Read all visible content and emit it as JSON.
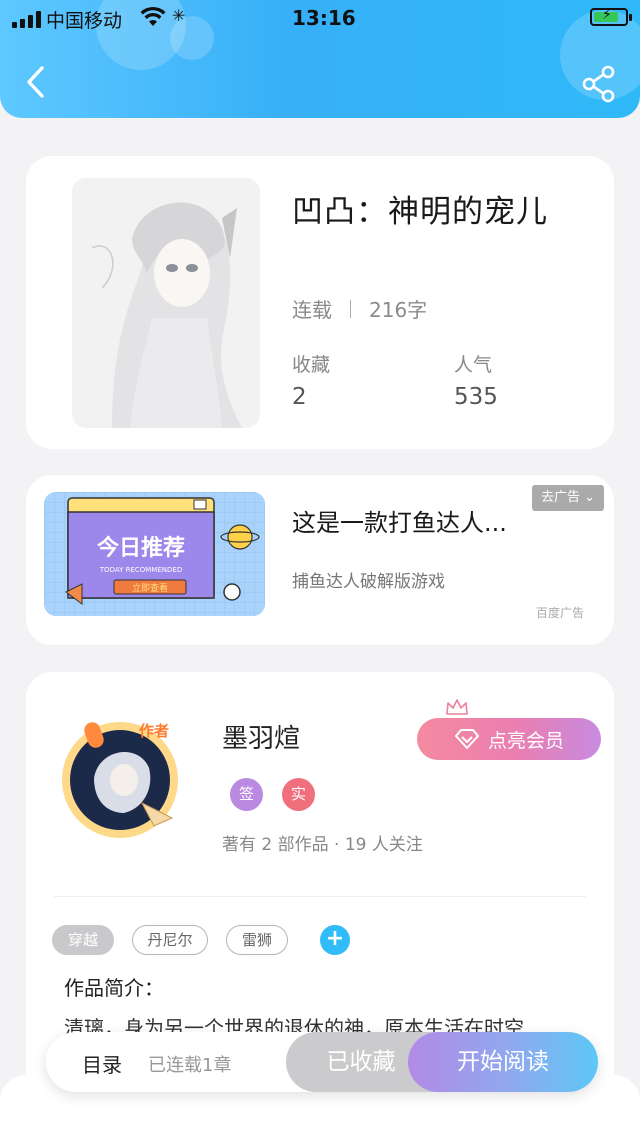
{
  "status_bar": {
    "carrier": "中国移动",
    "time": "13:16"
  },
  "header": {
    "back_icon": "chevron-left-icon",
    "share_icon": "share-icon"
  },
  "book": {
    "title": "凹凸：神明的宠儿",
    "status": "连载",
    "word_count": "216字",
    "favorites_label": "收藏",
    "favorites_value": "2",
    "popularity_label": "人气",
    "popularity_value": "535"
  },
  "ad": {
    "title": "这是一款打鱼达人...",
    "description": "捕鱼达人破解版游戏",
    "remove_label": "去广告",
    "source": "百度广告",
    "banner_title": "今日推荐",
    "banner_subtitle": "TODAY RECOMMENDED",
    "banner_button": "立即查看"
  },
  "author": {
    "avatar_tag": "作者",
    "name": "墨羽煊",
    "member_button": "点亮会员",
    "badge_signed": "签",
    "badge_real": "实",
    "works_info": "著有 2 部作品 · 19 人关注",
    "tags": [
      "穿越",
      "丹尼尔",
      "雷狮"
    ],
    "add_tag": "+",
    "intro_label": "作品简介：",
    "intro_text": "清璃，身为另一个世界的退休的神，原本生活在时空"
  },
  "bottom_bar": {
    "toc_label": "目录",
    "toc_count": "已连载1章",
    "collected_button": "已收藏",
    "read_button": "开始阅读"
  },
  "colors": {
    "header": "#37b0f8",
    "accent_blue": "#2fbcf8",
    "member_pink": "#f58aa0",
    "badge_purple": "#b98ae0",
    "badge_red": "#ef6f7c"
  }
}
